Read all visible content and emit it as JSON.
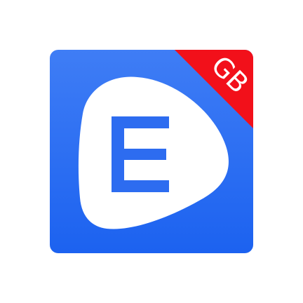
{
  "app_icon": {
    "badge_text": "GB",
    "logo_letter": "E",
    "colors": {
      "background": "#ffffff",
      "tile_top": "#3f7df5",
      "tile_bottom": "#1c62f0",
      "badge": "#f2101a",
      "play_shape": "#ffffff",
      "letter": "#2d6cf0"
    },
    "icons": [
      "play-bubble-icon",
      "letter-e-icon"
    ]
  }
}
